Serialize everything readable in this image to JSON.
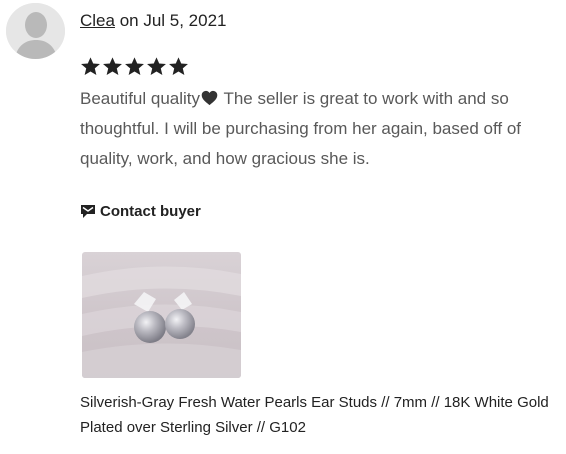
{
  "review": {
    "reviewer_name": "Clea",
    "date_text": " on Jul 5, 2021",
    "rating": 5,
    "rating_max": 5,
    "text_before_heart": "Beautiful quality",
    "heart_icon": "heart-icon",
    "text_after_heart": " The seller is great to work with and so thoughtful. I will be purchasing from her again, based off of quality, work, and how gracious she is.",
    "contact_label": "Contact buyer",
    "contact_icon": "message-icon"
  },
  "product": {
    "title": "Silverish-Gray Fresh Water Pearls Ear Studs // 7mm // 18K White Gold Plated over Sterling Silver // G102"
  },
  "colors": {
    "text": "#222222",
    "muted_text": "#595959",
    "avatar_bg": "#e8e8e8"
  }
}
